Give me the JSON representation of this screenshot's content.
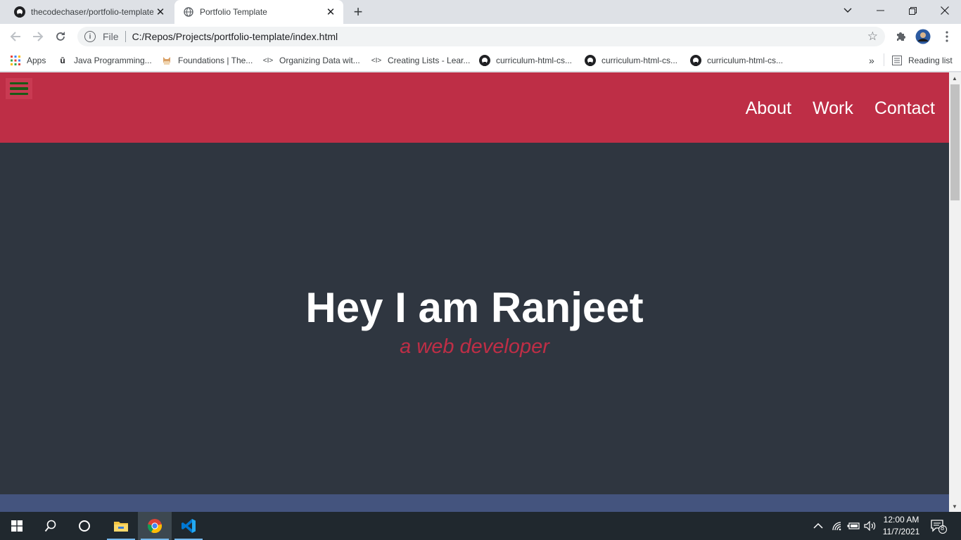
{
  "browser": {
    "tabs": [
      {
        "title": "thecodechaser/portfolio-template",
        "icon": "github-icon",
        "active": false
      },
      {
        "title": "Portfolio Template",
        "icon": "globe-icon",
        "active": true
      }
    ],
    "new_tab": "+",
    "address": {
      "scheme": "File",
      "url": "C:/Repos/Projects/portfolio-template/index.html"
    },
    "bookmarks": [
      {
        "label": "Apps",
        "icon": "apps-grid-icon"
      },
      {
        "label": "Java Programming...",
        "icon": "udemy-icon"
      },
      {
        "label": "Foundations | The...",
        "icon": "odin-icon"
      },
      {
        "label": "Organizing Data wit...",
        "icon": "code-icon"
      },
      {
        "label": "Creating Lists - Lear...",
        "icon": "code-icon"
      },
      {
        "label": "curriculum-html-cs...",
        "icon": "github-icon"
      },
      {
        "label": "curriculum-html-cs...",
        "icon": "github-icon"
      },
      {
        "label": "curriculum-html-cs...",
        "icon": "github-icon"
      }
    ],
    "bookmarks_overflow": "»",
    "reading_list": "Reading list"
  },
  "site": {
    "nav": [
      "About",
      "Work",
      "Contact"
    ],
    "hero_title": "Hey I am Ranjeet",
    "hero_subtitle": "a web developer"
  },
  "colors": {
    "header_bg": "#be2e46",
    "page_bg": "#2f3640",
    "accent": "#be2e46",
    "next_section": "#44547e"
  },
  "taskbar": {
    "time": "12:00 AM",
    "date": "11/7/2021",
    "notifications": "8",
    "apps": [
      "start-icon",
      "search-icon",
      "cortana-icon",
      "file-explorer-icon",
      "chrome-icon",
      "vscode-icon"
    ]
  }
}
